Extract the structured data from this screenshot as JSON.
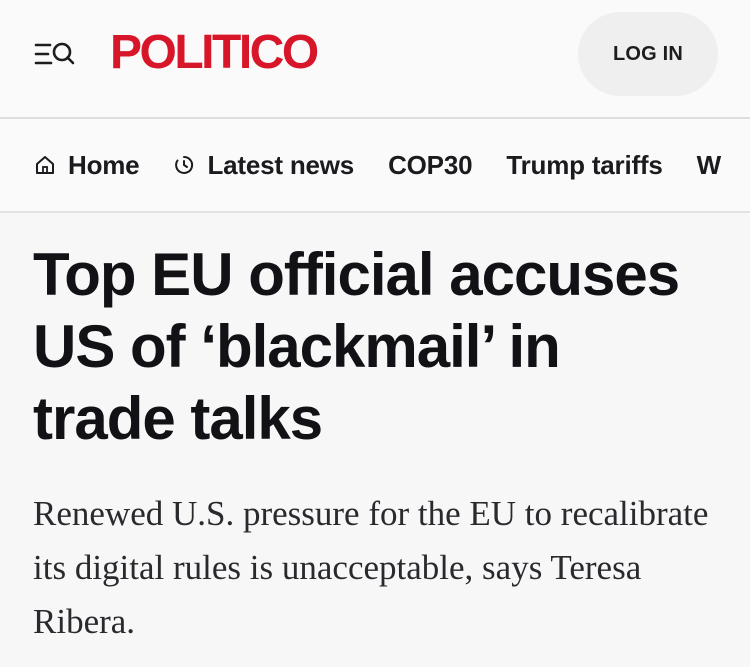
{
  "header": {
    "logo_text": "POLITICO",
    "logo_color": "#d8162a",
    "menu_icon": "menu-search-icon",
    "login_label": "LOG IN"
  },
  "nav": {
    "items": [
      {
        "label": "Home",
        "icon": "home-icon"
      },
      {
        "label": "Latest news",
        "icon": "clock-icon"
      },
      {
        "label": "COP30",
        "icon": ""
      },
      {
        "label": "Trump tariffs",
        "icon": ""
      },
      {
        "label": "W",
        "icon": ""
      }
    ]
  },
  "article": {
    "headline": "Top EU official accuses US of ‘blackmail’ in trade talks",
    "dek": "Renewed U.S. pressure for the EU to recalibrate its digital rules is unacceptable, says Teresa Ribera."
  }
}
